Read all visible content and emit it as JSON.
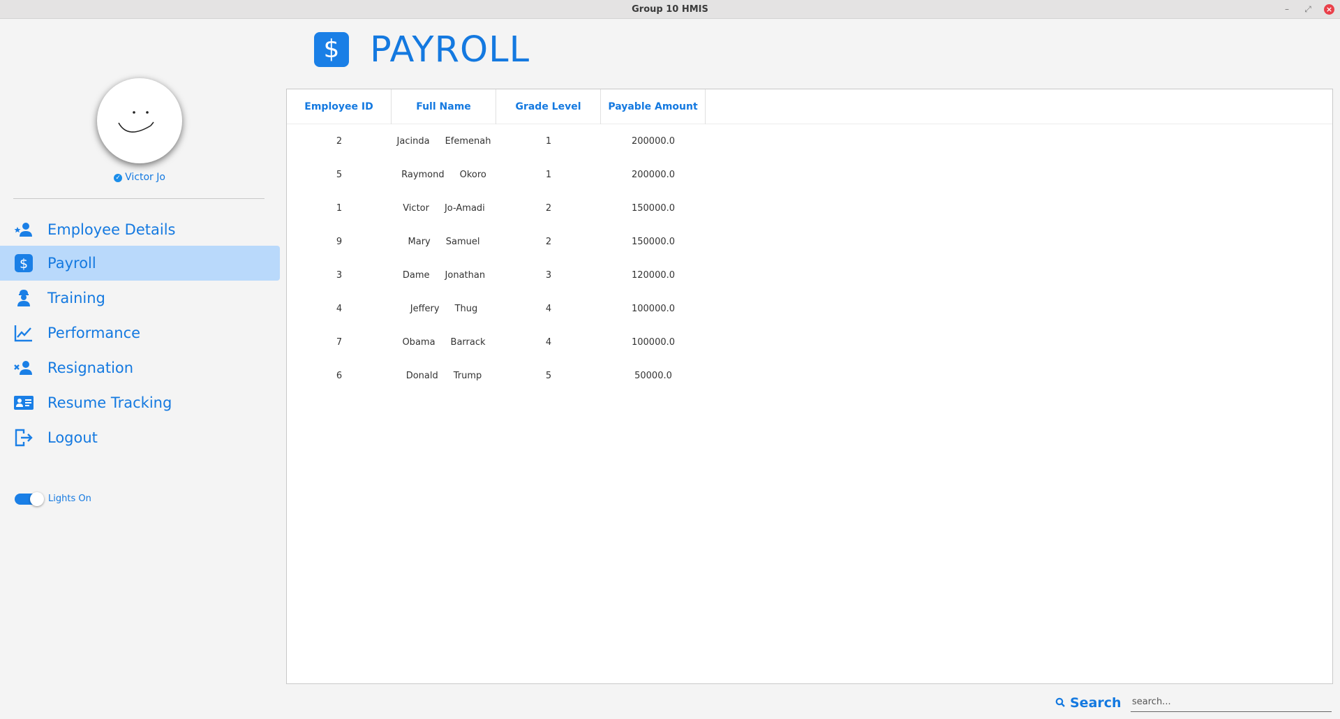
{
  "window": {
    "title": "Group 10 HMIS",
    "min_icon": "minimize-icon",
    "max_icon": "maximize-icon",
    "close_icon": "close-icon"
  },
  "sidebar": {
    "user_name": "Victor Jo",
    "items": [
      {
        "label": "Employee Details",
        "icon": "user-star-icon"
      },
      {
        "label": "Payroll",
        "icon": "dollar-icon",
        "active": true
      },
      {
        "label": "Training",
        "icon": "worker-icon"
      },
      {
        "label": "Performance",
        "icon": "line-chart-icon"
      },
      {
        "label": "Resignation",
        "icon": "user-remove-icon"
      },
      {
        "label": "Resume Tracking",
        "icon": "id-card-icon"
      },
      {
        "label": "Logout",
        "icon": "logout-icon"
      }
    ],
    "toggle_label": "Lights On",
    "toggle_on": true
  },
  "header": {
    "title": "PAYROLL",
    "icon_glyph": "$"
  },
  "table": {
    "columns": [
      "Employee ID",
      "Full Name",
      "Grade Level",
      "Payable Amount"
    ],
    "rows": [
      {
        "id": "2",
        "first": "Jacinda",
        "last": "Efemenah",
        "grade": "1",
        "amount": "200000.0"
      },
      {
        "id": "5",
        "first": "Raymond",
        "last": "Okoro",
        "grade": "1",
        "amount": "200000.0"
      },
      {
        "id": "1",
        "first": "Victor",
        "last": "Jo-Amadi",
        "grade": "2",
        "amount": "150000.0"
      },
      {
        "id": "9",
        "first": "Mary",
        "last": "Samuel",
        "grade": "2",
        "amount": "150000.0"
      },
      {
        "id": "3",
        "first": "Dame",
        "last": "Jonathan",
        "grade": "3",
        "amount": "120000.0"
      },
      {
        "id": "4",
        "first": "Jeffery",
        "last": "Thug",
        "grade": "4",
        "amount": "100000.0"
      },
      {
        "id": "7",
        "first": "Obama",
        "last": "Barrack",
        "grade": "4",
        "amount": "100000.0"
      },
      {
        "id": "6",
        "first": "Donald",
        "last": "Trump",
        "grade": "5",
        "amount": "50000.0"
      }
    ]
  },
  "search": {
    "label": "Search",
    "placeholder": "search...",
    "value": ""
  },
  "colors": {
    "accent": "#1479e0",
    "active_bg": "#b9d9fb",
    "close": "#e9404a"
  }
}
